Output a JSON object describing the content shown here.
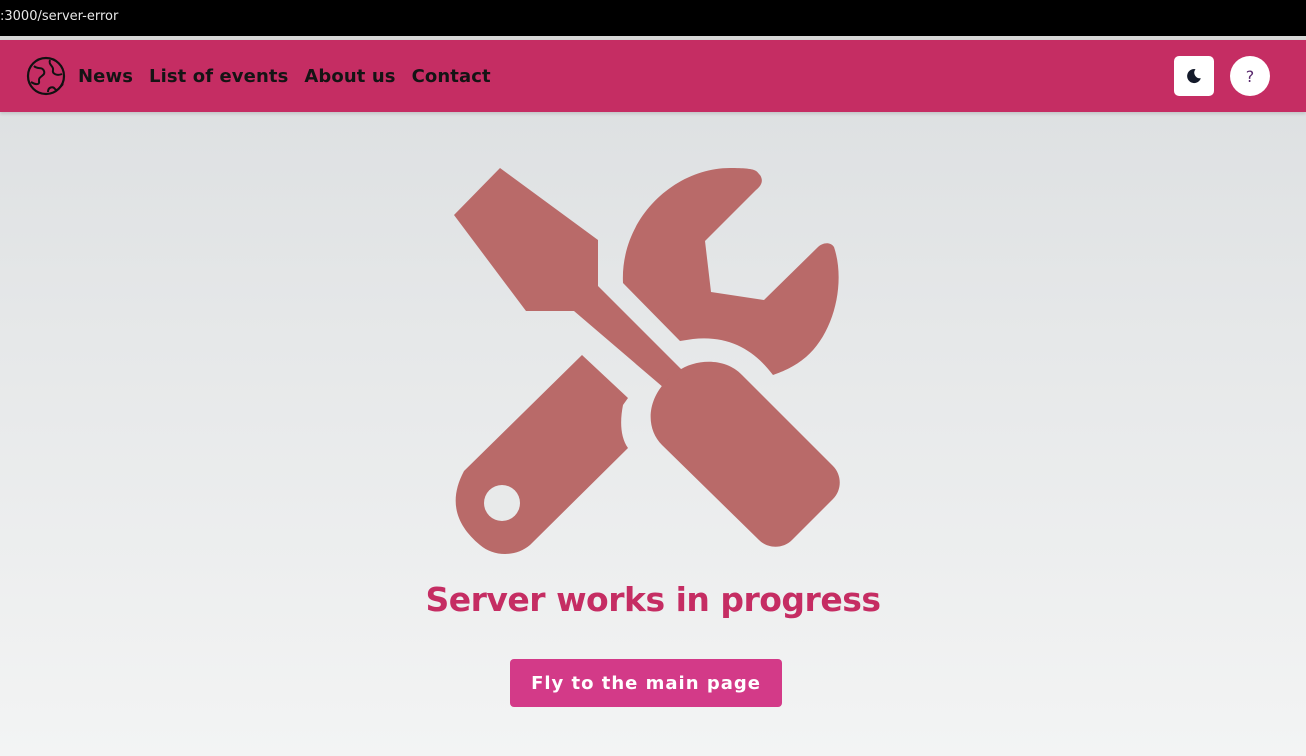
{
  "browser": {
    "url": ":3000/server-error"
  },
  "navbar": {
    "links": [
      "News",
      "List of events",
      "About us",
      "Contact"
    ],
    "help_label": "?"
  },
  "main": {
    "icon": "wrench-screwdriver-icon",
    "title": "Server works in progress",
    "button_label": "Fly to the main page"
  },
  "colors": {
    "navbar": "#c52d63",
    "title": "#c52d63",
    "button": "#d33a88",
    "icon": "#b96a69"
  }
}
